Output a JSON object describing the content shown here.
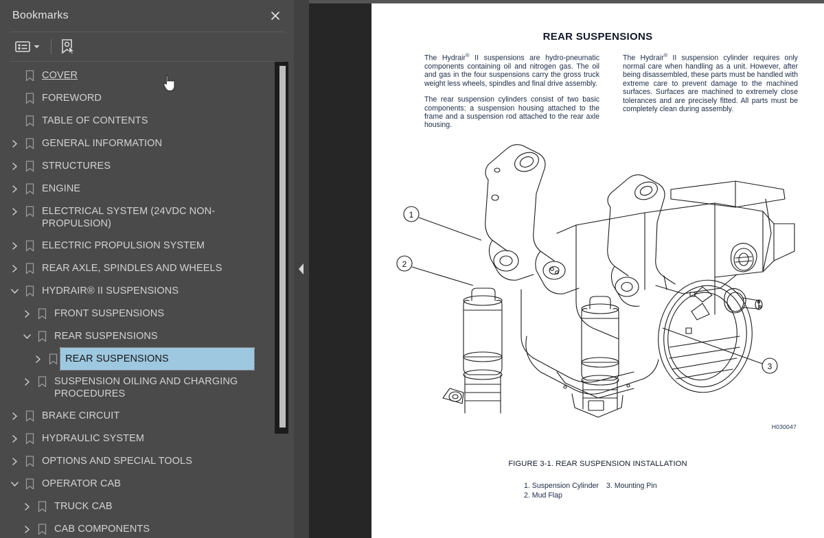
{
  "panel": {
    "title": "Bookmarks",
    "close_icon": "close-icon",
    "toolbar": {
      "options_label": "options-list-icon",
      "dropdown_icon": "chevron-down-icon",
      "new_bookmark_icon": "new-bookmark-icon"
    }
  },
  "bookmarks": [
    {
      "label": "COVER",
      "depth": 0,
      "twisty": "none",
      "state": "link",
      "selected": false
    },
    {
      "label": "FOREWORD",
      "depth": 0,
      "twisty": "none",
      "state": "normal",
      "selected": false
    },
    {
      "label": "TABLE OF CONTENTS",
      "depth": 0,
      "twisty": "none",
      "state": "normal",
      "selected": false
    },
    {
      "label": "GENERAL INFORMATION",
      "depth": 0,
      "twisty": "collapsed",
      "state": "normal",
      "selected": false
    },
    {
      "label": "STRUCTURES",
      "depth": 0,
      "twisty": "collapsed",
      "state": "normal",
      "selected": false
    },
    {
      "label": "ENGINE",
      "depth": 0,
      "twisty": "collapsed",
      "state": "normal",
      "selected": false
    },
    {
      "label": "ELECTRICAL SYSTEM (24VDC NON-PROPULSION)",
      "depth": 0,
      "twisty": "collapsed",
      "state": "normal",
      "selected": false
    },
    {
      "label": "ELECTRIC PROPULSION SYSTEM",
      "depth": 0,
      "twisty": "collapsed",
      "state": "normal",
      "selected": false
    },
    {
      "label": "REAR AXLE, SPINDLES AND WHEELS",
      "depth": 0,
      "twisty": "collapsed",
      "state": "normal",
      "selected": false
    },
    {
      "label": "HYDRAIR® II SUSPENSIONS",
      "depth": 0,
      "twisty": "expanded",
      "state": "normal",
      "selected": false
    },
    {
      "label": "FRONT SUSPENSIONS",
      "depth": 1,
      "twisty": "collapsed",
      "state": "normal",
      "selected": false
    },
    {
      "label": "REAR SUSPENSIONS",
      "depth": 1,
      "twisty": "expanded",
      "state": "normal",
      "selected": false
    },
    {
      "label": "REAR SUSPENSIONS",
      "depth": 2,
      "twisty": "collapsed",
      "state": "normal",
      "selected": true
    },
    {
      "label": "SUSPENSION OILING AND CHARGING\nPROCEDURES",
      "depth": 1,
      "twisty": "collapsed",
      "state": "normal",
      "selected": false
    },
    {
      "label": "BRAKE CIRCUIT",
      "depth": 0,
      "twisty": "collapsed",
      "state": "normal",
      "selected": false
    },
    {
      "label": "HYDRAULIC SYSTEM",
      "depth": 0,
      "twisty": "collapsed",
      "state": "normal",
      "selected": false
    },
    {
      "label": "OPTIONS AND SPECIAL TOOLS",
      "depth": 0,
      "twisty": "collapsed",
      "state": "normal",
      "selected": false
    },
    {
      "label": "OPERATOR CAB",
      "depth": 0,
      "twisty": "expanded",
      "state": "normal",
      "selected": false
    },
    {
      "label": "TRUCK CAB",
      "depth": 1,
      "twisty": "collapsed",
      "state": "normal",
      "selected": false
    },
    {
      "label": "CAB COMPONENTS",
      "depth": 1,
      "twisty": "collapsed",
      "state": "normal",
      "selected": false
    }
  ],
  "document": {
    "title": "REAR SUSPENSIONS",
    "columns": [
      [
        "The Hydrair® II suspensions are hydro-pneumatic components containing oil and nitrogen gas. The oil and gas in the four suspensions carry the gross truck weight less wheels, spindles and final drive assembly.",
        "The rear suspension cylinders consist of two basic components: a suspension housing attached to the frame and a suspension rod attached to the rear axle housing."
      ],
      [
        "The Hydrair® II suspension cylinder requires only normal care when handling as a unit. However, after being disassembled, these parts must be handled with extreme care to prevent damage to the machined surfaces. Surfaces are machined to extremely close tolerances and are precisely fitted. All parts must be completely clean during assembly."
      ]
    ],
    "drawing_number": "H030047",
    "figure_caption": "FIGURE 3-1. REAR SUSPENSION INSTALLATION",
    "legend_left": [
      "1. Suspension Cylinder",
      "2. Mud Flap"
    ],
    "legend_right": [
      "3. Mounting Pin"
    ],
    "callouts": [
      "1",
      "2",
      "3"
    ]
  },
  "colors": {
    "panel_bg": "#4a4a4a",
    "doc_bg": "#262626",
    "selection": "#9ec7e0",
    "text": "#d2d2d2",
    "page": "#ffffff"
  }
}
